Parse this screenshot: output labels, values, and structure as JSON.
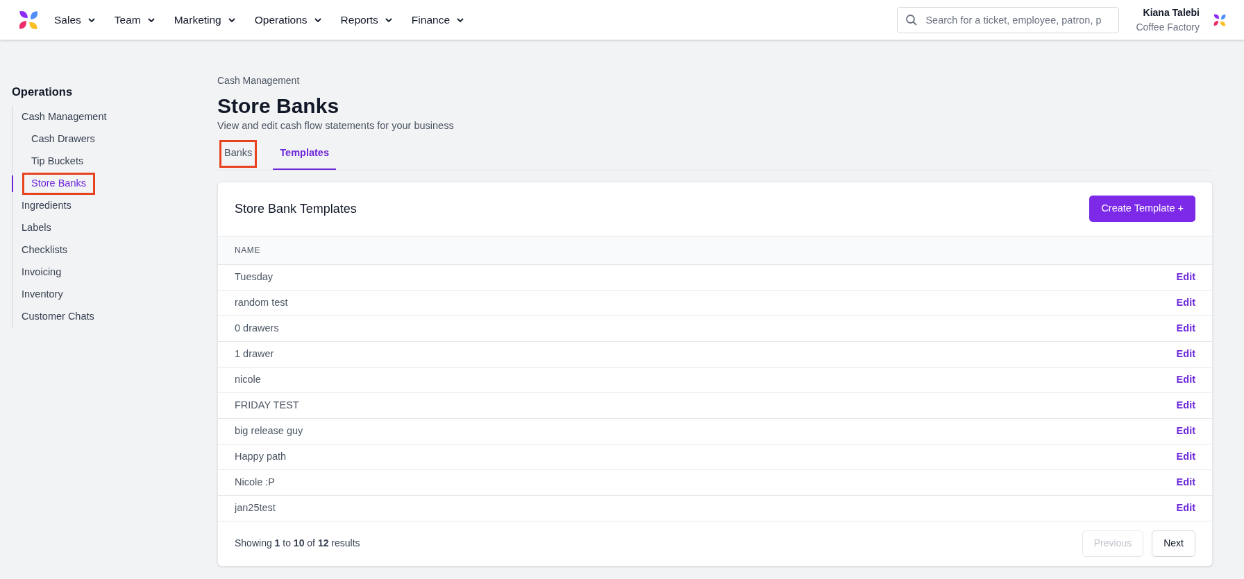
{
  "nav": [
    {
      "label": "Sales"
    },
    {
      "label": "Team"
    },
    {
      "label": "Marketing"
    },
    {
      "label": "Operations"
    },
    {
      "label": "Reports"
    },
    {
      "label": "Finance"
    }
  ],
  "search": {
    "placeholder": "Search for a ticket, employee, patron, p"
  },
  "user": {
    "name": "Kiana Talebi",
    "org": "Coffee Factory"
  },
  "sidebar": {
    "title": "Operations",
    "items": [
      {
        "label": "Cash Management",
        "selected": false,
        "highlighted": false,
        "children": [
          {
            "label": "Cash Drawers",
            "selected": false,
            "highlighted": false
          },
          {
            "label": "Tip Buckets",
            "selected": false,
            "highlighted": false
          },
          {
            "label": "Store Banks",
            "selected": true,
            "highlighted": true
          }
        ]
      },
      {
        "label": "Ingredients",
        "selected": false,
        "highlighted": false
      },
      {
        "label": "Labels",
        "selected": false,
        "highlighted": false
      },
      {
        "label": "Checklists",
        "selected": false,
        "highlighted": false
      },
      {
        "label": "Invoicing",
        "selected": false,
        "highlighted": false
      },
      {
        "label": "Inventory",
        "selected": false,
        "highlighted": false
      },
      {
        "label": "Customer Chats",
        "selected": false,
        "highlighted": false
      }
    ]
  },
  "breadcrumb": "Cash Management",
  "title": "Store Banks",
  "subtitle": "View and edit cash flow statements for your business",
  "tabs": [
    {
      "label": "Banks",
      "selected": false,
      "highlighted": true
    },
    {
      "label": "Templates",
      "selected": true,
      "highlighted": false
    }
  ],
  "card": {
    "title": "Store Bank Templates",
    "create_button": "Create Template +",
    "table": {
      "columns": [
        "NAME"
      ],
      "rows": [
        {
          "name": "Tuesday",
          "action": "Edit"
        },
        {
          "name": "random test",
          "action": "Edit"
        },
        {
          "name": "0 drawers",
          "action": "Edit"
        },
        {
          "name": "1 drawer",
          "action": "Edit"
        },
        {
          "name": "nicole",
          "action": "Edit"
        },
        {
          "name": "FRIDAY TEST",
          "action": "Edit"
        },
        {
          "name": "big release guy",
          "action": "Edit"
        },
        {
          "name": "Happy path",
          "action": "Edit"
        },
        {
          "name": "Nicole :P",
          "action": "Edit"
        },
        {
          "name": "jan25test",
          "action": "Edit"
        }
      ]
    },
    "footer": {
      "summary": "Showing **1** to **10** of **12** results",
      "previous": {
        "label": "Previous",
        "disabled": true
      },
      "next": {
        "label": "Next",
        "disabled": false
      }
    }
  }
}
